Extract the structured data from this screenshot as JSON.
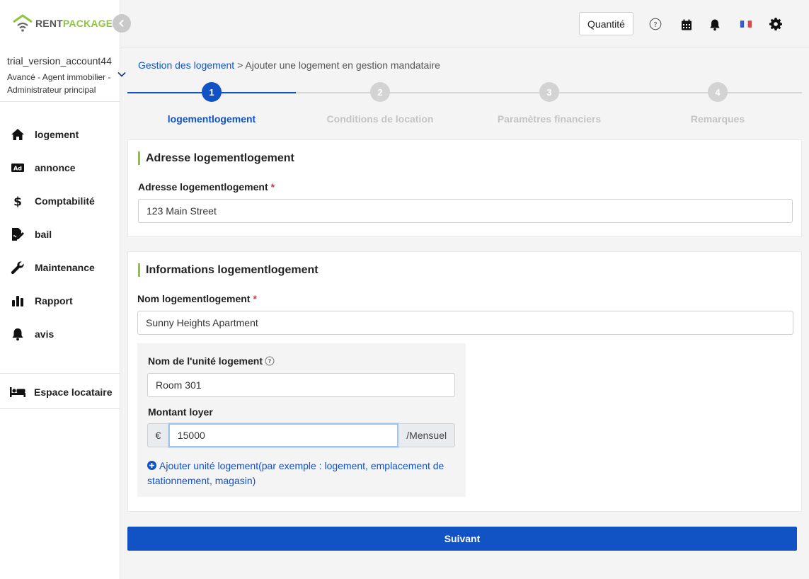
{
  "brand": {
    "part1": "RENT",
    "part2": "PACKAGE",
    "green": "#8cc63f",
    "gray": "#555555"
  },
  "account": {
    "name": "trial_version_account44",
    "role": "Avancé - Agent immobilier - Administrateur principal"
  },
  "nav": {
    "items": [
      {
        "label": "logement",
        "icon": "home-icon"
      },
      {
        "label": "annonce",
        "icon": "ad-icon"
      },
      {
        "label": "Comptabilité",
        "icon": "dollar-icon"
      },
      {
        "label": "bail",
        "icon": "contract-icon"
      },
      {
        "label": "Maintenance",
        "icon": "wrench-icon"
      },
      {
        "label": "Rapport",
        "icon": "bar-chart-icon"
      },
      {
        "label": "avis",
        "icon": "bell-icon"
      }
    ],
    "tenant_space": {
      "label": "Espace locataire",
      "icon": "bed-icon"
    }
  },
  "header": {
    "quantity_label": "Quantité",
    "icons": [
      "help-icon",
      "calendar-icon",
      "bell-icon",
      "flag-fr-icon",
      "gear-icon"
    ]
  },
  "breadcrumb": {
    "link": "Gestion des logement",
    "separator": " > ",
    "current": "Ajouter une logement en gestion mandataire"
  },
  "stepper": {
    "steps": [
      {
        "number": "1",
        "label": "logementlogement",
        "active": true
      },
      {
        "number": "2",
        "label": "Conditions de location",
        "active": false
      },
      {
        "number": "3",
        "label": "Paramètres financiers",
        "active": false
      },
      {
        "number": "4",
        "label": "Remarques",
        "active": false
      }
    ],
    "active_color": "#1152c4"
  },
  "address_card": {
    "title": "Adresse logementlogement",
    "field_label": "Adresse logementlogement",
    "required_mark": "*",
    "value": "123 Main Street"
  },
  "info_card": {
    "title": "Informations logementlogement",
    "name_label": "Nom logementlogement",
    "required_mark": "*",
    "name_value": "Sunny Heights Apartment",
    "unit": {
      "name_label": "Nom de l'unité logement",
      "name_value": "Room 301",
      "rent_label": "Montant loyer",
      "currency": "€",
      "rent_value": "15000",
      "period": "/Mensuel",
      "add_link": "Ajouter unité logement(par exemple : logement, emplacement de stationnement, magasin)"
    }
  },
  "next_button": "Suivant"
}
